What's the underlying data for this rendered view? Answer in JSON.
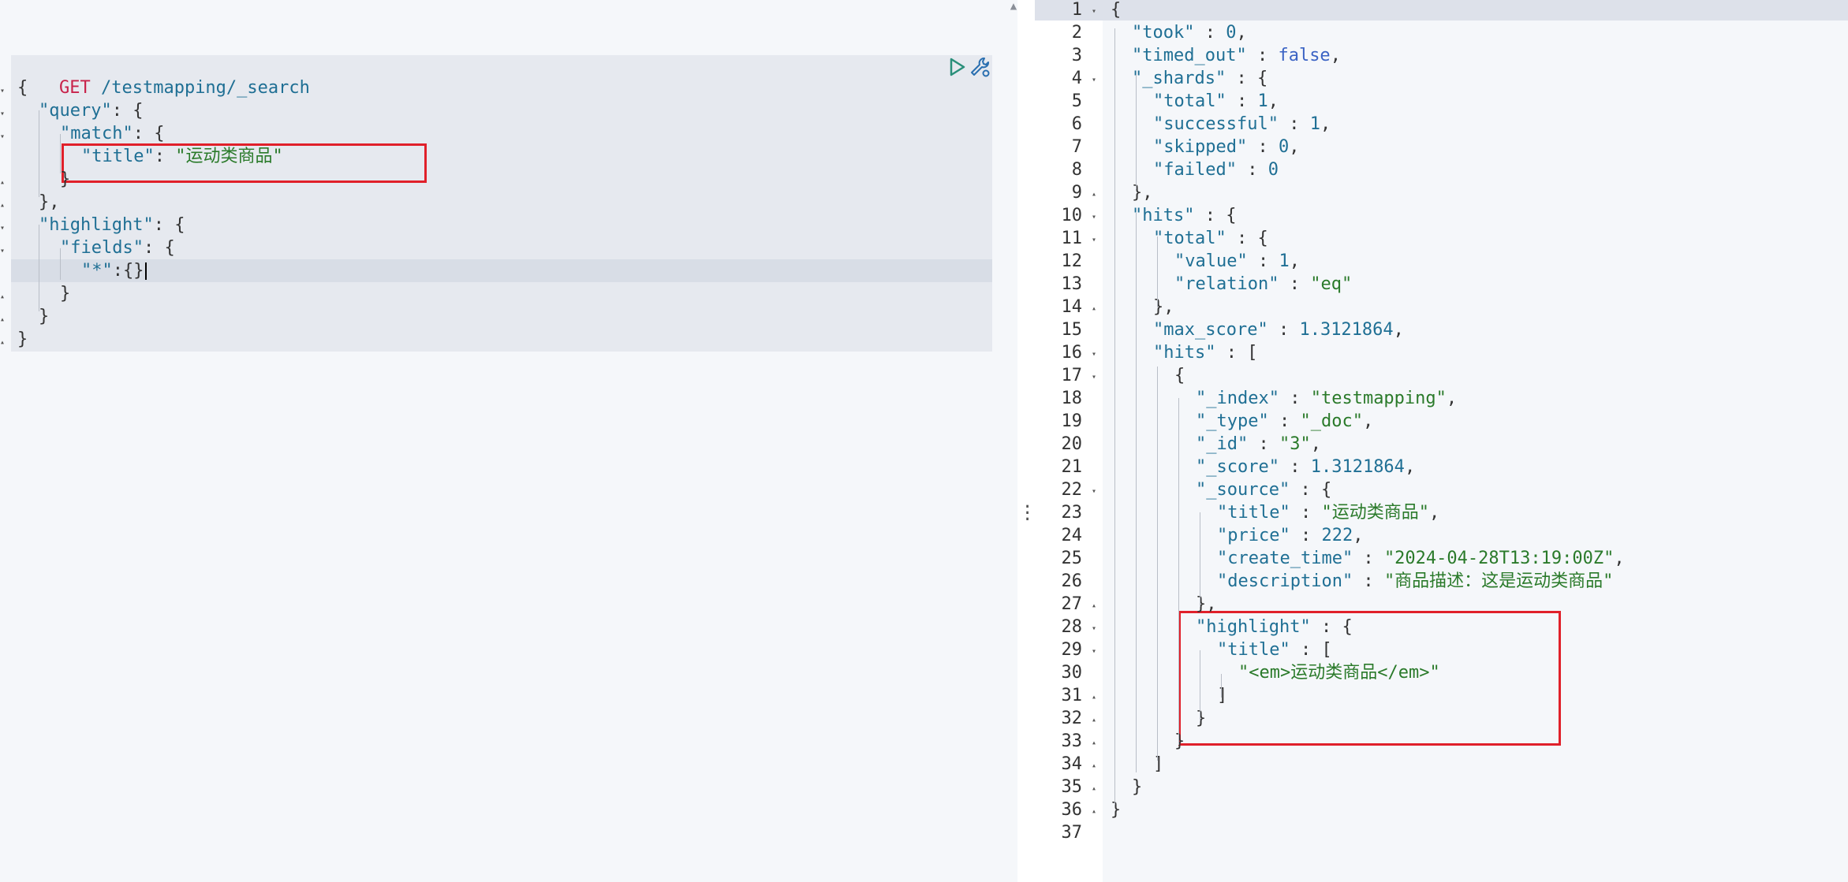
{
  "request": {
    "method": "GET",
    "path": "/testmapping/_search",
    "lines": [
      {
        "indent": 0,
        "tokens": [
          [
            "pun",
            "{"
          ]
        ]
      },
      {
        "indent": 1,
        "tokens": [
          [
            "key",
            "\"query\""
          ],
          [
            "pun",
            ": {"
          ]
        ]
      },
      {
        "indent": 2,
        "tokens": [
          [
            "key",
            "\"match\""
          ],
          [
            "pun",
            ": {"
          ]
        ]
      },
      {
        "indent": 3,
        "tokens": [
          [
            "key",
            "\"title\""
          ],
          [
            "pun",
            ": "
          ],
          [
            "str",
            "\"运动类商品\""
          ]
        ]
      },
      {
        "indent": 2,
        "tokens": [
          [
            "pun",
            "}"
          ]
        ]
      },
      {
        "indent": 1,
        "tokens": [
          [
            "pun",
            "},"
          ]
        ]
      },
      {
        "indent": 1,
        "tokens": [
          [
            "key",
            "\"highlight\""
          ],
          [
            "pun",
            ": {"
          ]
        ]
      },
      {
        "indent": 2,
        "tokens": [
          [
            "key",
            "\"fields\""
          ],
          [
            "pun",
            ": {"
          ]
        ]
      },
      {
        "indent": 3,
        "tokens": [
          [
            "key",
            "\"*\""
          ],
          [
            "pun",
            ":{}"
          ]
        ]
      },
      {
        "indent": 2,
        "tokens": [
          [
            "pun",
            "}"
          ]
        ]
      },
      {
        "indent": 1,
        "tokens": [
          [
            "pun",
            "}"
          ]
        ]
      },
      {
        "indent": 0,
        "tokens": [
          [
            "pun",
            "}"
          ]
        ]
      }
    ]
  },
  "toolbar": {
    "run_icon": "play-icon",
    "settings_icon": "wrench-icon"
  },
  "response": {
    "lines": [
      {
        "n": "1",
        "fold": "down",
        "indent": 0,
        "tokens": [
          [
            "pun",
            "{"
          ]
        ]
      },
      {
        "n": "2",
        "indent": 1,
        "tokens": [
          [
            "key",
            "\"took\""
          ],
          [
            "pun",
            " : "
          ],
          [
            "num",
            "0"
          ],
          [
            "pun",
            ","
          ]
        ]
      },
      {
        "n": "3",
        "indent": 1,
        "tokens": [
          [
            "key",
            "\"timed_out\""
          ],
          [
            "pun",
            " : "
          ],
          [
            "bool",
            "false"
          ],
          [
            "pun",
            ","
          ]
        ]
      },
      {
        "n": "4",
        "fold": "down",
        "indent": 1,
        "tokens": [
          [
            "key",
            "\"_shards\""
          ],
          [
            "pun",
            " : {"
          ]
        ]
      },
      {
        "n": "5",
        "indent": 2,
        "tokens": [
          [
            "key",
            "\"total\""
          ],
          [
            "pun",
            " : "
          ],
          [
            "num",
            "1"
          ],
          [
            "pun",
            ","
          ]
        ]
      },
      {
        "n": "6",
        "indent": 2,
        "tokens": [
          [
            "key",
            "\"successful\""
          ],
          [
            "pun",
            " : "
          ],
          [
            "num",
            "1"
          ],
          [
            "pun",
            ","
          ]
        ]
      },
      {
        "n": "7",
        "indent": 2,
        "tokens": [
          [
            "key",
            "\"skipped\""
          ],
          [
            "pun",
            " : "
          ],
          [
            "num",
            "0"
          ],
          [
            "pun",
            ","
          ]
        ]
      },
      {
        "n": "8",
        "indent": 2,
        "tokens": [
          [
            "key",
            "\"failed\""
          ],
          [
            "pun",
            " : "
          ],
          [
            "num",
            "0"
          ]
        ]
      },
      {
        "n": "9",
        "fold": "up",
        "indent": 1,
        "tokens": [
          [
            "pun",
            "},"
          ]
        ]
      },
      {
        "n": "10",
        "fold": "down",
        "indent": 1,
        "tokens": [
          [
            "key",
            "\"hits\""
          ],
          [
            "pun",
            " : {"
          ]
        ]
      },
      {
        "n": "11",
        "fold": "down",
        "indent": 2,
        "tokens": [
          [
            "key",
            "\"total\""
          ],
          [
            "pun",
            " : {"
          ]
        ]
      },
      {
        "n": "12",
        "indent": 3,
        "tokens": [
          [
            "key",
            "\"value\""
          ],
          [
            "pun",
            " : "
          ],
          [
            "num",
            "1"
          ],
          [
            "pun",
            ","
          ]
        ]
      },
      {
        "n": "13",
        "indent": 3,
        "tokens": [
          [
            "key",
            "\"relation\""
          ],
          [
            "pun",
            " : "
          ],
          [
            "str",
            "\"eq\""
          ]
        ]
      },
      {
        "n": "14",
        "fold": "up",
        "indent": 2,
        "tokens": [
          [
            "pun",
            "},"
          ]
        ]
      },
      {
        "n": "15",
        "indent": 2,
        "tokens": [
          [
            "key",
            "\"max_score\""
          ],
          [
            "pun",
            " : "
          ],
          [
            "num",
            "1.3121864"
          ],
          [
            "pun",
            ","
          ]
        ]
      },
      {
        "n": "16",
        "fold": "down",
        "indent": 2,
        "tokens": [
          [
            "key",
            "\"hits\""
          ],
          [
            "pun",
            " : ["
          ]
        ]
      },
      {
        "n": "17",
        "fold": "down",
        "indent": 3,
        "tokens": [
          [
            "pun",
            "{"
          ]
        ]
      },
      {
        "n": "18",
        "indent": 4,
        "tokens": [
          [
            "key",
            "\"_index\""
          ],
          [
            "pun",
            " : "
          ],
          [
            "str",
            "\"testmapping\""
          ],
          [
            "pun",
            ","
          ]
        ]
      },
      {
        "n": "19",
        "indent": 4,
        "tokens": [
          [
            "key",
            "\"_type\""
          ],
          [
            "pun",
            " : "
          ],
          [
            "str",
            "\"_doc\""
          ],
          [
            "pun",
            ","
          ]
        ]
      },
      {
        "n": "20",
        "indent": 4,
        "tokens": [
          [
            "key",
            "\"_id\""
          ],
          [
            "pun",
            " : "
          ],
          [
            "str",
            "\"3\""
          ],
          [
            "pun",
            ","
          ]
        ]
      },
      {
        "n": "21",
        "indent": 4,
        "tokens": [
          [
            "key",
            "\"_score\""
          ],
          [
            "pun",
            " : "
          ],
          [
            "num",
            "1.3121864"
          ],
          [
            "pun",
            ","
          ]
        ]
      },
      {
        "n": "22",
        "fold": "down",
        "indent": 4,
        "tokens": [
          [
            "key",
            "\"_source\""
          ],
          [
            "pun",
            " : {"
          ]
        ]
      },
      {
        "n": "23",
        "indent": 5,
        "tokens": [
          [
            "key",
            "\"title\""
          ],
          [
            "pun",
            " : "
          ],
          [
            "str",
            "\"运动类商品\""
          ],
          [
            "pun",
            ","
          ]
        ]
      },
      {
        "n": "24",
        "indent": 5,
        "tokens": [
          [
            "key",
            "\"price\""
          ],
          [
            "pun",
            " : "
          ],
          [
            "num",
            "222"
          ],
          [
            "pun",
            ","
          ]
        ]
      },
      {
        "n": "25",
        "indent": 5,
        "tokens": [
          [
            "key",
            "\"create_time\""
          ],
          [
            "pun",
            " : "
          ],
          [
            "str",
            "\"2024-04-28T13:19:00Z\""
          ],
          [
            "pun",
            ","
          ]
        ]
      },
      {
        "n": "26",
        "indent": 5,
        "tokens": [
          [
            "key",
            "\"description\""
          ],
          [
            "pun",
            " : "
          ],
          [
            "str",
            "\"商品描述：这是运动类商品\""
          ]
        ]
      },
      {
        "n": "27",
        "fold": "up",
        "indent": 4,
        "tokens": [
          [
            "pun",
            "},"
          ]
        ]
      },
      {
        "n": "28",
        "fold": "down",
        "indent": 4,
        "tokens": [
          [
            "key",
            "\"highlight\""
          ],
          [
            "pun",
            " : {"
          ]
        ]
      },
      {
        "n": "29",
        "fold": "down",
        "indent": 5,
        "tokens": [
          [
            "key",
            "\"title\""
          ],
          [
            "pun",
            " : ["
          ]
        ]
      },
      {
        "n": "30",
        "indent": 6,
        "tokens": [
          [
            "str",
            "\"<em>运动类商品</em>\""
          ]
        ]
      },
      {
        "n": "31",
        "fold": "up",
        "indent": 5,
        "tokens": [
          [
            "pun",
            "]"
          ]
        ]
      },
      {
        "n": "32",
        "fold": "up",
        "indent": 4,
        "tokens": [
          [
            "pun",
            "}"
          ]
        ]
      },
      {
        "n": "33",
        "fold": "up",
        "indent": 3,
        "tokens": [
          [
            "pun",
            "}"
          ]
        ]
      },
      {
        "n": "34",
        "fold": "up",
        "indent": 2,
        "tokens": [
          [
            "pun",
            "]"
          ]
        ]
      },
      {
        "n": "35",
        "fold": "up",
        "indent": 1,
        "tokens": [
          [
            "pun",
            "}"
          ]
        ]
      },
      {
        "n": "36",
        "fold": "up",
        "indent": 0,
        "tokens": [
          [
            "pun",
            "}"
          ]
        ]
      },
      {
        "n": "37",
        "indent": 0,
        "tokens": []
      }
    ]
  },
  "colors": {
    "highlight_box": "#e0202a",
    "method": "#c8224a",
    "key": "#1f6f94",
    "string": "#2a7a2a"
  }
}
